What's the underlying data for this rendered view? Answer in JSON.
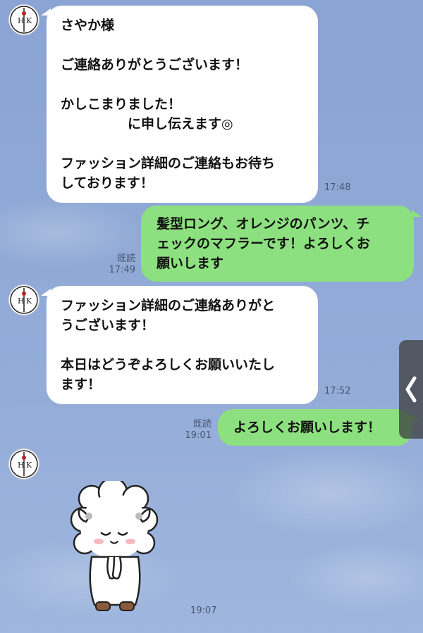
{
  "chat": {
    "messages": [
      {
        "direction": "in",
        "lines": [
          "さやか様",
          "",
          "ご連絡ありがとうございます！",
          "",
          "かしこまりました！",
          "　　　　　に申し伝えます◎",
          "",
          "ファッション詳細のご連絡もお待ち",
          "しております！"
        ],
        "time": "17:48"
      },
      {
        "direction": "out",
        "lines": [
          "髪型ロング、オレンジのパンツ、チ",
          "ェックのマフラーです！よろしくお",
          "願いします"
        ],
        "read": "既読",
        "time": "17:49"
      },
      {
        "direction": "in",
        "lines": [
          "ファッション詳細のご連絡ありがと",
          "うございます！",
          "",
          "本日はどうぞよろしくお願いいたし",
          "ます！"
        ],
        "time": "17:52"
      },
      {
        "direction": "out",
        "lines": [
          "よろしくお願いします！"
        ],
        "read": "既読",
        "time": "19:01"
      },
      {
        "direction": "in",
        "type": "sticker",
        "sticker": "bowing-sheep-sticker",
        "time": "19:07"
      }
    ]
  },
  "avatar": {
    "icon": "hk-monogram-avatar",
    "monogram_left": "H",
    "monogram_right": "K"
  },
  "side_panel": {
    "icon": "chevron-left-icon"
  },
  "colors": {
    "background": "#8fa9d6",
    "incoming_bubble": "#ffffff",
    "outgoing_bubble": "#8de07f"
  }
}
